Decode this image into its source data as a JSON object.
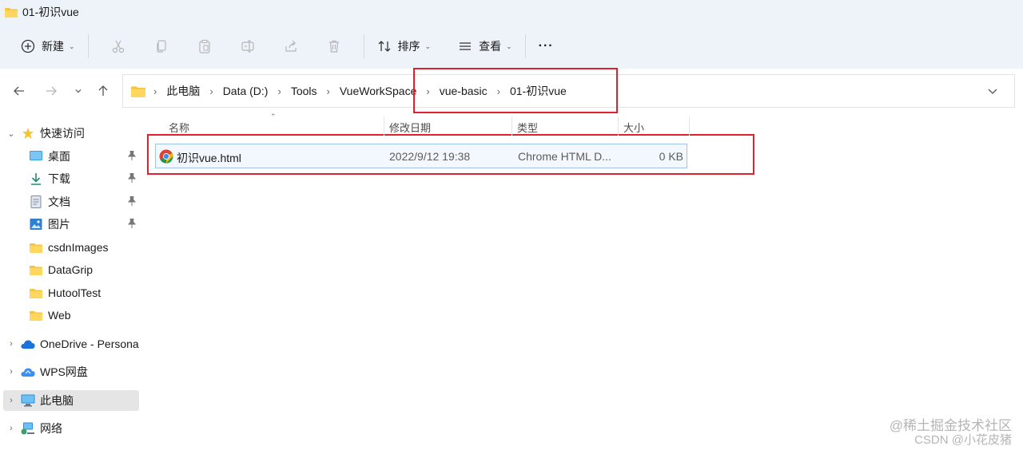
{
  "window": {
    "title": "01-初识vue"
  },
  "toolbar": {
    "new_label": "新建",
    "sort_label": "排序",
    "view_label": "查看",
    "more_label": "···"
  },
  "address": {
    "crumbs": [
      "此电脑",
      "Data (D:)",
      "Tools",
      "VueWorkSpace",
      "vue-basic",
      "01-初识vue"
    ]
  },
  "sidebar": {
    "quick_access": "快速访问",
    "items": [
      "桌面",
      "下载",
      "文档",
      "图片",
      "csdnImages",
      "DataGrip",
      "HutoolTest",
      "Web"
    ],
    "onedrive": "OneDrive - Persona",
    "wps": "WPS网盘",
    "this_pc": "此电脑",
    "network": "网络"
  },
  "columns": {
    "name": "名称",
    "modified": "修改日期",
    "type": "类型",
    "size": "大小"
  },
  "files": [
    {
      "name": "初识vue.html",
      "modified": "2022/9/12 19:38",
      "type": "Chrome HTML D...",
      "size": "0 KB"
    }
  ],
  "watermark": {
    "line1": "@稀土掘金技术社区",
    "line2": "CSDN @小花皮猪"
  },
  "colors": {
    "accent": "#9fc6ea",
    "highlight": "#e0202a",
    "folder": "#f4c542"
  }
}
